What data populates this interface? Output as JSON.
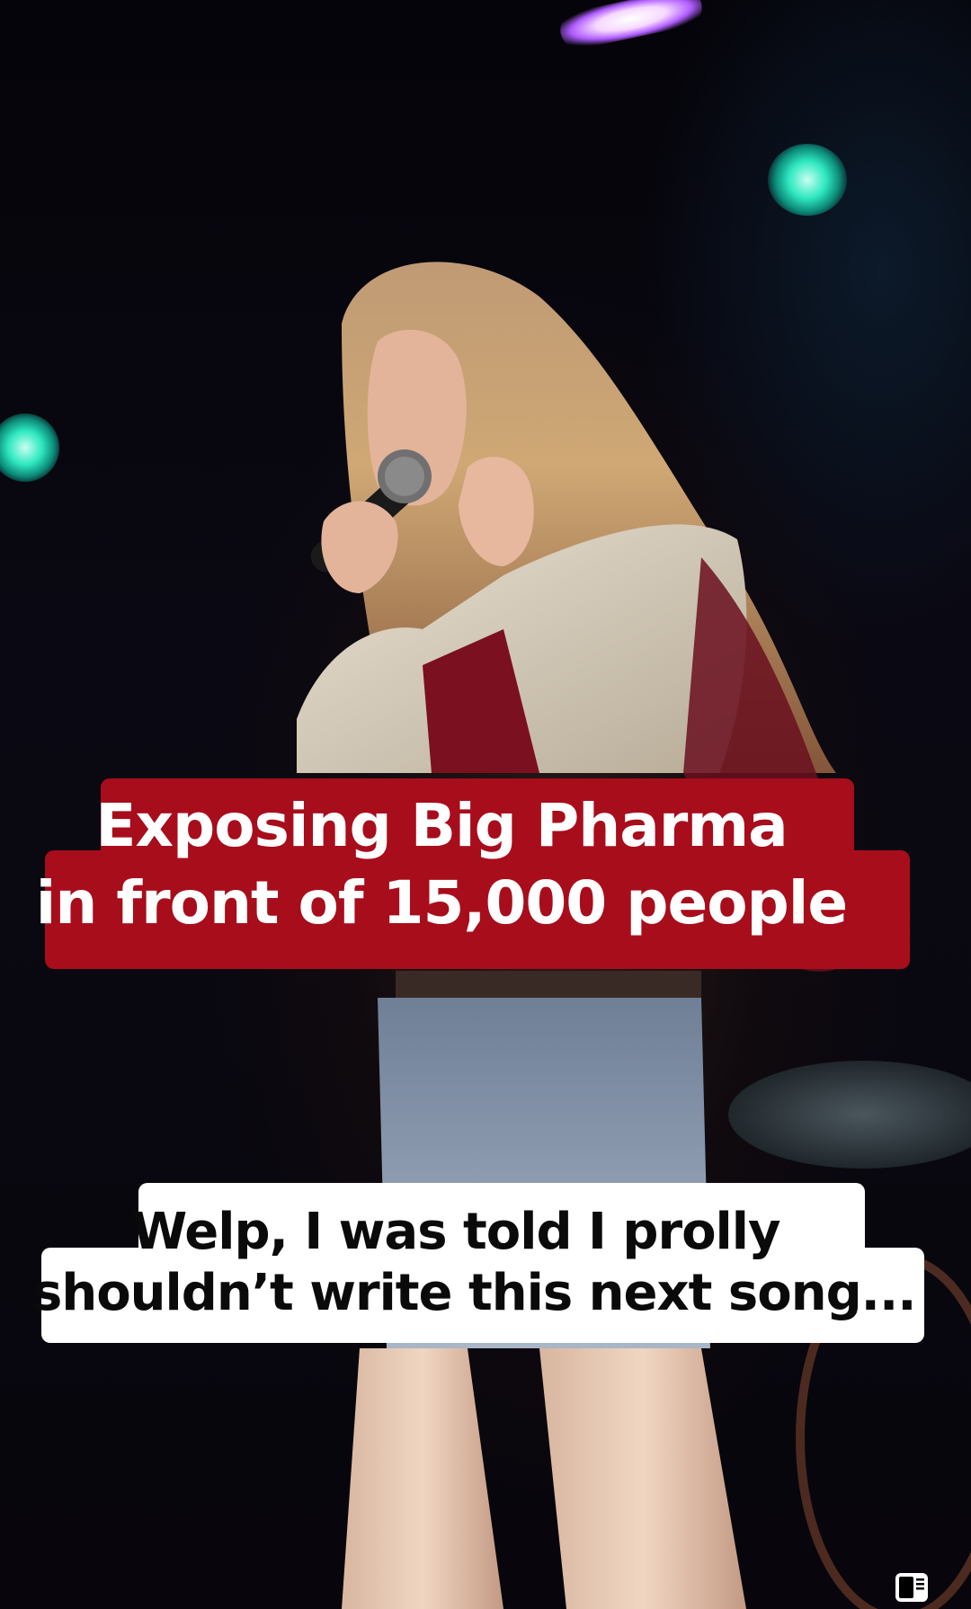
{
  "video": {
    "caption_title": {
      "line1": "Exposing Big Pharma",
      "line2": "in front of 15,000 people",
      "background_color": "#a80d1c"
    },
    "caption_subtitle": {
      "line1": "Welp, I was told I prolly",
      "line2": "shouldn’t write this next song...",
      "background_color": "#ffffff"
    }
  },
  "controls": {
    "pip_icon": "picture-in-picture-icon"
  }
}
